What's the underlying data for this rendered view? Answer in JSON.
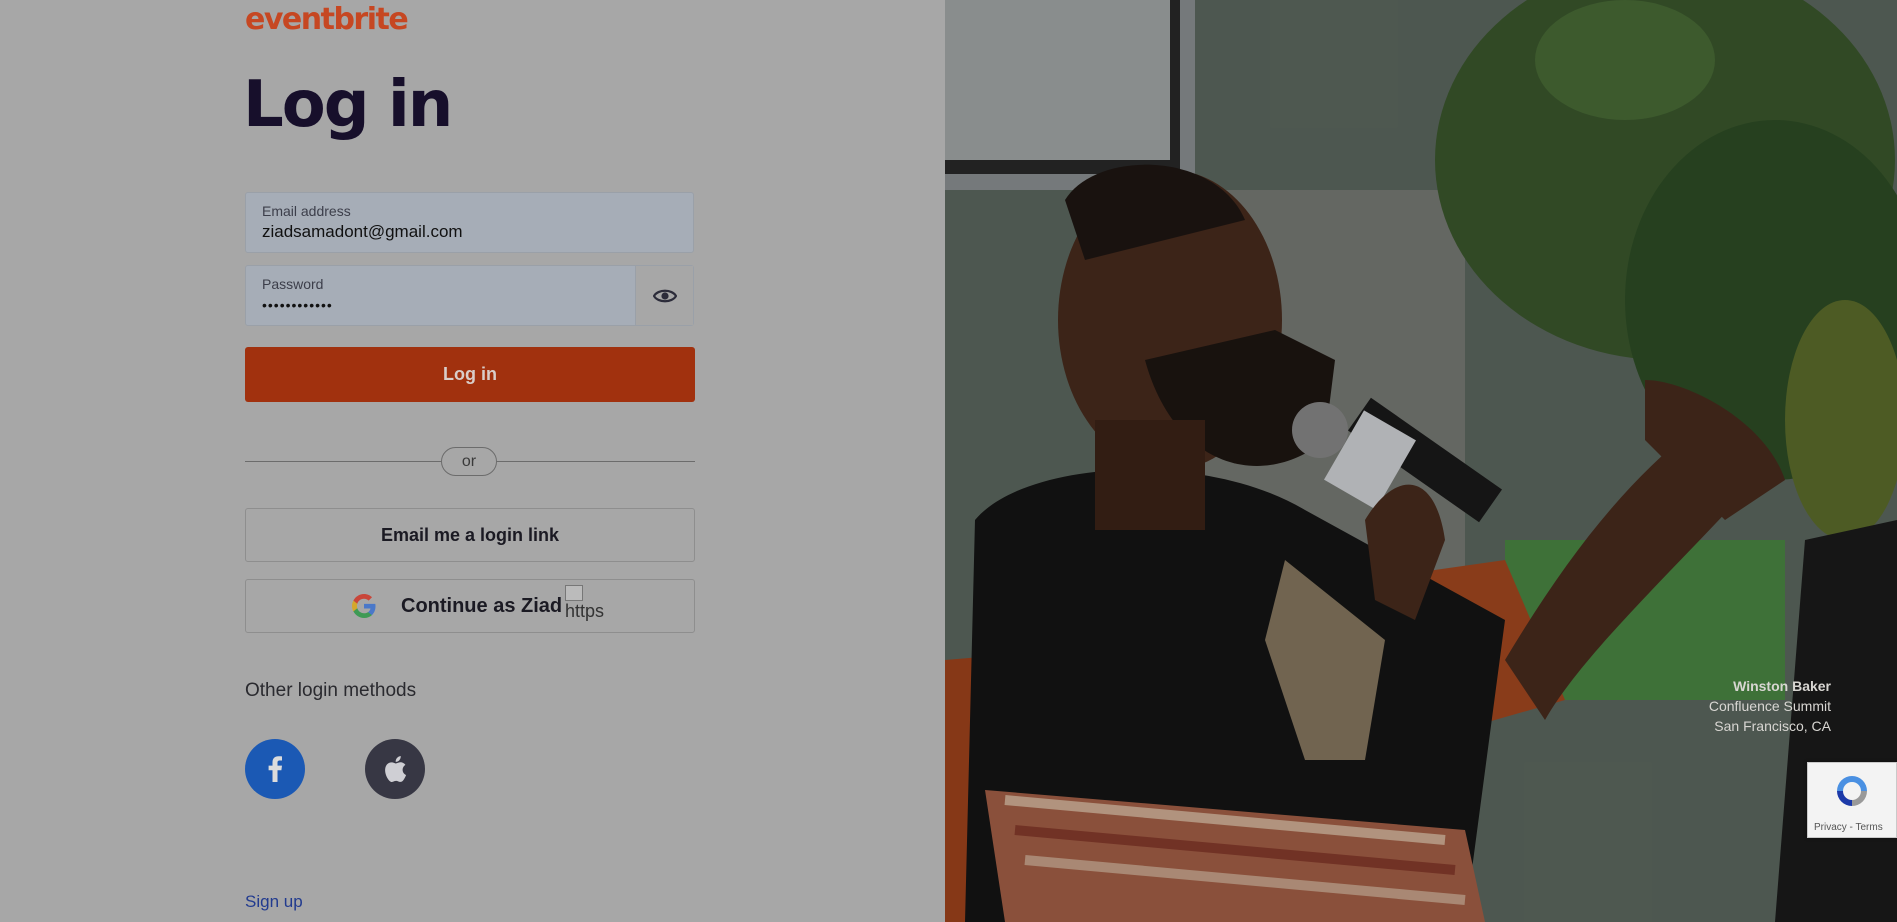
{
  "brand": {
    "logo_text": "eventbrite",
    "accent": "#c64722",
    "primary_button_color": "#a1310e"
  },
  "page": {
    "title": "Log in"
  },
  "form": {
    "email": {
      "label": "Email address",
      "value": "ziadsamadont@gmail.com"
    },
    "password": {
      "label": "Password",
      "value": "••••••••••••",
      "toggle_icon": "eye-icon"
    },
    "submit_label": "Log in"
  },
  "divider": {
    "label": "or"
  },
  "alt_buttons": {
    "email_link_label": "Email me a login link",
    "google_label": "Continue as Ziad",
    "google_broken_image_alt": "https"
  },
  "other_methods": {
    "heading": "Other login methods",
    "providers": [
      {
        "icon": "facebook-icon",
        "color": "#1b59b4"
      },
      {
        "icon": "apple-icon",
        "color": "#373744"
      }
    ]
  },
  "footer": {
    "signup_label": "Sign up"
  },
  "photo": {
    "credit_name": "Winston Baker",
    "credit_event": "Confluence Summit",
    "credit_location": "San Francisco, CA"
  },
  "recaptcha": {
    "terms": "Privacy - Terms"
  }
}
